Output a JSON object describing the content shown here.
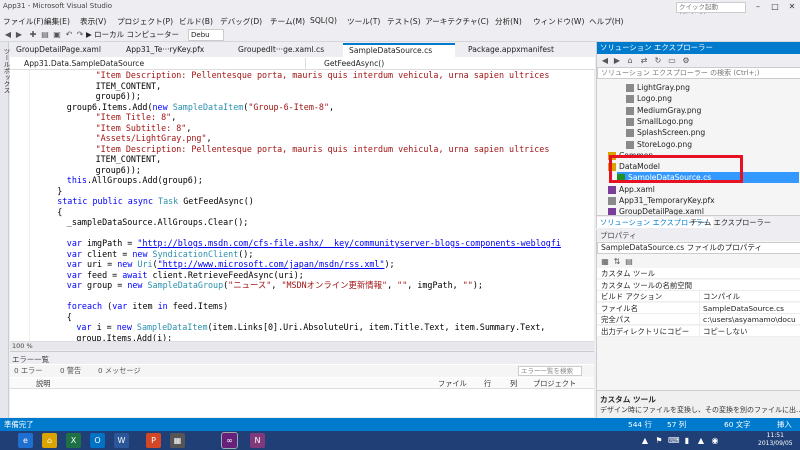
{
  "window": {
    "title": "App31 - Microsoft Visual Studio",
    "quick_launch_placeholder": "クイック起動 (Ctrl+Q)",
    "controls": [
      "–",
      "□",
      "✕"
    ]
  },
  "menu": [
    "ファイル(F)",
    "編集(E)",
    "表示(V)",
    "プロジェクト(P)",
    "ビルド(B)",
    "デバッグ(D)",
    "チーム(M)",
    "SQL(Q)",
    "ツール(T)",
    "テスト(S)",
    "アーキテクチャ(C)",
    "分析(N)",
    "ウィンドウ(W)",
    "ヘルプ(H)"
  ],
  "toolbar": {
    "debug_target": "▶ ローカル コンピューター",
    "config": "Debu"
  },
  "left_strip_label": "ツールボックス",
  "tabs": [
    "GroupDetailPage.xaml",
    "App31_Te···ryKey.pfx",
    "GroupedIt···ge.xaml.cs",
    "SampleDataSource.cs",
    "Package.appxmanifest"
  ],
  "active_tab_index": 3,
  "navbar": {
    "left": "App31.Data.SampleDataSource",
    "right": "GetFeedAsync()"
  },
  "code_lines": [
    [
      [
        "st",
        "\"Item Description: Pellentesque porta, mauris quis interdum vehicula, urna sapien ultrices"
      ]
    ],
    [
      [
        "",
        "ITEM_CONTENT,"
      ]
    ],
    [
      [
        "",
        "group6));"
      ]
    ],
    [
      [
        "",
        "group6.Items.Add("
      ],
      [
        "kw",
        "new "
      ],
      [
        "ty",
        "SampleDataItem"
      ],
      [
        "",
        "("
      ],
      [
        "st",
        "\"Group-6-Item-8\""
      ],
      [
        "",
        ","
      ]
    ],
    [
      [
        "st",
        "\"Item Title: 8\""
      ],
      [
        "",
        ","
      ]
    ],
    [
      [
        "st",
        "\"Item Subtitle: 8\""
      ],
      [
        "",
        ","
      ]
    ],
    [
      [
        "st",
        "\"Assets/LightGray.png\""
      ],
      [
        "",
        ","
      ]
    ],
    [
      [
        "st",
        "\"Item Description: Pellentesque porta, mauris quis interdum vehicula, urna sapien ultrices"
      ]
    ],
    [
      [
        "",
        "ITEM_CONTENT,"
      ]
    ],
    [
      [
        "",
        "group6));"
      ]
    ],
    [
      [
        "kw",
        "this"
      ],
      [
        "",
        ".AllGroups.Add(group6);"
      ]
    ],
    [
      [
        "",
        "}"
      ]
    ],
    [
      [
        "kw",
        "static public async "
      ],
      [
        "ty",
        "Task "
      ],
      [
        "",
        "GetFeedAsync()"
      ]
    ],
    [
      [
        "",
        "{"
      ]
    ],
    [
      [
        "",
        "_sampleDataSource.AllGroups.Clear();"
      ]
    ],
    [
      [
        "",
        ""
      ]
    ],
    [
      [
        "kw",
        "var "
      ],
      [
        "",
        "imgPath = "
      ],
      [
        "ln",
        "\"http://blogs.msdn.com/cfs-file.ashx/__key/communityserver-blogs-components-weblogfi"
      ]
    ],
    [
      [
        "kw",
        "var "
      ],
      [
        "",
        "client = "
      ],
      [
        "kw",
        "new "
      ],
      [
        "ty",
        "SyndicationClient"
      ],
      [
        "",
        "();"
      ]
    ],
    [
      [
        "kw",
        "var "
      ],
      [
        "",
        "uri = "
      ],
      [
        "kw",
        "new "
      ],
      [
        "ty",
        "Uri"
      ],
      [
        "",
        "("
      ],
      [
        "ln",
        "\"http://www.microsoft.com/japan/msdn/rss.xml\""
      ],
      [
        "",
        ");"
      ]
    ],
    [
      [
        "kw",
        "var "
      ],
      [
        "",
        "feed = "
      ],
      [
        "kw",
        "await "
      ],
      [
        "",
        "client.RetrieveFeedAsync(uri);"
      ]
    ],
    [
      [
        "kw",
        "var "
      ],
      [
        "",
        "group = "
      ],
      [
        "kw",
        "new "
      ],
      [
        "ty",
        "SampleDataGroup"
      ],
      [
        "",
        "("
      ],
      [
        "st",
        "\"ニュース\""
      ],
      [
        "",
        ", "
      ],
      [
        "st",
        "\"MSDNオンライン更新情報\""
      ],
      [
        "",
        ", "
      ],
      [
        "st",
        "\"\""
      ],
      [
        "",
        ", imgPath, "
      ],
      [
        "st",
        "\"\""
      ],
      [
        "",
        ");"
      ]
    ],
    [
      [
        "",
        ""
      ]
    ],
    [
      [
        "kw",
        "foreach "
      ],
      [
        "",
        "("
      ],
      [
        "kw",
        "var "
      ],
      [
        "",
        "item "
      ],
      [
        "kw",
        "in "
      ],
      [
        "",
        "feed.Items)"
      ]
    ],
    [
      [
        "",
        "{"
      ]
    ],
    [
      [
        "kw",
        "var "
      ],
      [
        "",
        "i = "
      ],
      [
        "kw",
        "new "
      ],
      [
        "ty",
        "SampleDataItem"
      ],
      [
        "",
        "(item.Links[0].Uri.AbsoluteUri, item.Title.Text, item.Summary.Text,"
      ]
    ],
    [
      [
        "",
        "group.Items.Add(i);"
      ]
    ]
  ],
  "code_indent": [
    6,
    6,
    6,
    3,
    6,
    6,
    6,
    6,
    6,
    6,
    3,
    2,
    2,
    2,
    3,
    0,
    3,
    3,
    3,
    3,
    3,
    0,
    3,
    3,
    4,
    4
  ],
  "zoom": "100 %",
  "error_list": {
    "title": "エラー一覧",
    "filters": [
      "0 エラー",
      "0 警告",
      "0 メッセージ"
    ],
    "search_placeholder": "エラー一覧を検索",
    "columns": [
      "説明",
      "ファイル",
      "行",
      "列",
      "プロジェクト"
    ]
  },
  "solution_explorer": {
    "title": "ソリューション エクスプローラー",
    "search_placeholder": "ソリューション エクスプローラー の検索 (Ctrl+;)",
    "items": [
      {
        "label": "LightGray.png",
        "indent": 3,
        "kind": "file"
      },
      {
        "label": "Logo.png",
        "indent": 3,
        "kind": "file"
      },
      {
        "label": "MediumGray.png",
        "indent": 3,
        "kind": "file"
      },
      {
        "label": "SmallLogo.png",
        "indent": 3,
        "kind": "file"
      },
      {
        "label": "SplashScreen.png",
        "indent": 3,
        "kind": "file"
      },
      {
        "label": "StoreLogo.png",
        "indent": 3,
        "kind": "file"
      },
      {
        "label": "Common",
        "indent": 1,
        "kind": "folder"
      },
      {
        "label": "DataModel",
        "indent": 1,
        "kind": "folder"
      },
      {
        "label": "SampleDataSource.cs",
        "indent": 2,
        "kind": "cs",
        "selected": true
      },
      {
        "label": "App.xaml",
        "indent": 1,
        "kind": "xaml"
      },
      {
        "label": "App31_TemporaryKey.pfx",
        "indent": 1,
        "kind": "file"
      },
      {
        "label": "GroupDetailPage.xaml",
        "indent": 1,
        "kind": "xaml"
      }
    ],
    "tabs": [
      "ソリューション エクスプローラー",
      "チーム エクスプローラー"
    ]
  },
  "properties": {
    "title": "プロパティ",
    "object": "SampleDataSource.cs ファイルのプロパティ",
    "rows": [
      {
        "k": "カスタム ツール",
        "v": ""
      },
      {
        "k": "カスタム ツールの名前空間",
        "v": ""
      },
      {
        "k": "ビルド アクション",
        "v": "コンパイル"
      },
      {
        "k": "ファイル名",
        "v": "SampleDataSource.cs"
      },
      {
        "k": "完全パス",
        "v": "c:\\users\\asyamamo\\docu"
      },
      {
        "k": "出力ディレクトリにコピー",
        "v": "コピーしない"
      }
    ],
    "desc_title": "カスタム ツール",
    "desc_text": "デザイン時にファイルを変換し、その変換を別のファイルに出..."
  },
  "status": {
    "left": "準備完了",
    "line": "544 行",
    "col": "57 列",
    "char": "60 文字",
    "mode": "挿入"
  },
  "taskbar": {
    "apps": [
      "e",
      "⌂",
      "X",
      "O",
      "W",
      "P",
      "▦",
      "∞",
      "N"
    ],
    "time": "11:51",
    "date": "2013/09/05"
  },
  "colors": {
    "accent": "#007acc",
    "highlight": "#e81123",
    "selected": "#3399ff",
    "taskbar": "#1f3f76"
  }
}
